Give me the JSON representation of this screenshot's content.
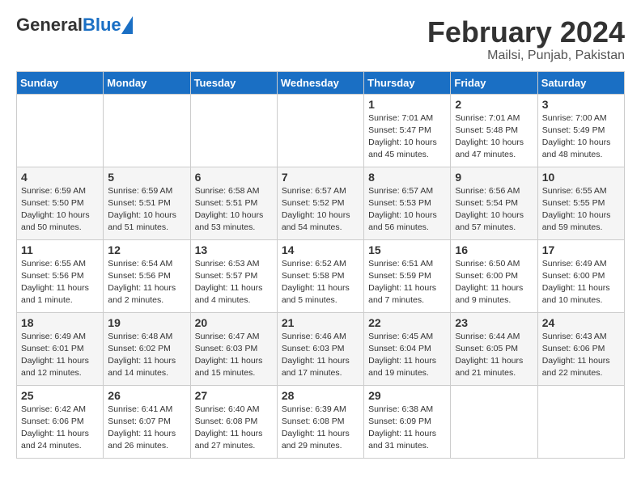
{
  "header": {
    "logo_general": "General",
    "logo_blue": "Blue",
    "month_title": "February 2024",
    "location": "Mailsi, Punjab, Pakistan"
  },
  "days_of_week": [
    "Sunday",
    "Monday",
    "Tuesday",
    "Wednesday",
    "Thursday",
    "Friday",
    "Saturday"
  ],
  "weeks": [
    [
      {
        "day": "",
        "info": ""
      },
      {
        "day": "",
        "info": ""
      },
      {
        "day": "",
        "info": ""
      },
      {
        "day": "",
        "info": ""
      },
      {
        "day": "1",
        "info": "Sunrise: 7:01 AM\nSunset: 5:47 PM\nDaylight: 10 hours\nand 45 minutes."
      },
      {
        "day": "2",
        "info": "Sunrise: 7:01 AM\nSunset: 5:48 PM\nDaylight: 10 hours\nand 47 minutes."
      },
      {
        "day": "3",
        "info": "Sunrise: 7:00 AM\nSunset: 5:49 PM\nDaylight: 10 hours\nand 48 minutes."
      }
    ],
    [
      {
        "day": "4",
        "info": "Sunrise: 6:59 AM\nSunset: 5:50 PM\nDaylight: 10 hours\nand 50 minutes."
      },
      {
        "day": "5",
        "info": "Sunrise: 6:59 AM\nSunset: 5:51 PM\nDaylight: 10 hours\nand 51 minutes."
      },
      {
        "day": "6",
        "info": "Sunrise: 6:58 AM\nSunset: 5:51 PM\nDaylight: 10 hours\nand 53 minutes."
      },
      {
        "day": "7",
        "info": "Sunrise: 6:57 AM\nSunset: 5:52 PM\nDaylight: 10 hours\nand 54 minutes."
      },
      {
        "day": "8",
        "info": "Sunrise: 6:57 AM\nSunset: 5:53 PM\nDaylight: 10 hours\nand 56 minutes."
      },
      {
        "day": "9",
        "info": "Sunrise: 6:56 AM\nSunset: 5:54 PM\nDaylight: 10 hours\nand 57 minutes."
      },
      {
        "day": "10",
        "info": "Sunrise: 6:55 AM\nSunset: 5:55 PM\nDaylight: 10 hours\nand 59 minutes."
      }
    ],
    [
      {
        "day": "11",
        "info": "Sunrise: 6:55 AM\nSunset: 5:56 PM\nDaylight: 11 hours\nand 1 minute."
      },
      {
        "day": "12",
        "info": "Sunrise: 6:54 AM\nSunset: 5:56 PM\nDaylight: 11 hours\nand 2 minutes."
      },
      {
        "day": "13",
        "info": "Sunrise: 6:53 AM\nSunset: 5:57 PM\nDaylight: 11 hours\nand 4 minutes."
      },
      {
        "day": "14",
        "info": "Sunrise: 6:52 AM\nSunset: 5:58 PM\nDaylight: 11 hours\nand 5 minutes."
      },
      {
        "day": "15",
        "info": "Sunrise: 6:51 AM\nSunset: 5:59 PM\nDaylight: 11 hours\nand 7 minutes."
      },
      {
        "day": "16",
        "info": "Sunrise: 6:50 AM\nSunset: 6:00 PM\nDaylight: 11 hours\nand 9 minutes."
      },
      {
        "day": "17",
        "info": "Sunrise: 6:49 AM\nSunset: 6:00 PM\nDaylight: 11 hours\nand 10 minutes."
      }
    ],
    [
      {
        "day": "18",
        "info": "Sunrise: 6:49 AM\nSunset: 6:01 PM\nDaylight: 11 hours\nand 12 minutes."
      },
      {
        "day": "19",
        "info": "Sunrise: 6:48 AM\nSunset: 6:02 PM\nDaylight: 11 hours\nand 14 minutes."
      },
      {
        "day": "20",
        "info": "Sunrise: 6:47 AM\nSunset: 6:03 PM\nDaylight: 11 hours\nand 15 minutes."
      },
      {
        "day": "21",
        "info": "Sunrise: 6:46 AM\nSunset: 6:03 PM\nDaylight: 11 hours\nand 17 minutes."
      },
      {
        "day": "22",
        "info": "Sunrise: 6:45 AM\nSunset: 6:04 PM\nDaylight: 11 hours\nand 19 minutes."
      },
      {
        "day": "23",
        "info": "Sunrise: 6:44 AM\nSunset: 6:05 PM\nDaylight: 11 hours\nand 21 minutes."
      },
      {
        "day": "24",
        "info": "Sunrise: 6:43 AM\nSunset: 6:06 PM\nDaylight: 11 hours\nand 22 minutes."
      }
    ],
    [
      {
        "day": "25",
        "info": "Sunrise: 6:42 AM\nSunset: 6:06 PM\nDaylight: 11 hours\nand 24 minutes."
      },
      {
        "day": "26",
        "info": "Sunrise: 6:41 AM\nSunset: 6:07 PM\nDaylight: 11 hours\nand 26 minutes."
      },
      {
        "day": "27",
        "info": "Sunrise: 6:40 AM\nSunset: 6:08 PM\nDaylight: 11 hours\nand 27 minutes."
      },
      {
        "day": "28",
        "info": "Sunrise: 6:39 AM\nSunset: 6:08 PM\nDaylight: 11 hours\nand 29 minutes."
      },
      {
        "day": "29",
        "info": "Sunrise: 6:38 AM\nSunset: 6:09 PM\nDaylight: 11 hours\nand 31 minutes."
      },
      {
        "day": "",
        "info": ""
      },
      {
        "day": "",
        "info": ""
      }
    ]
  ]
}
